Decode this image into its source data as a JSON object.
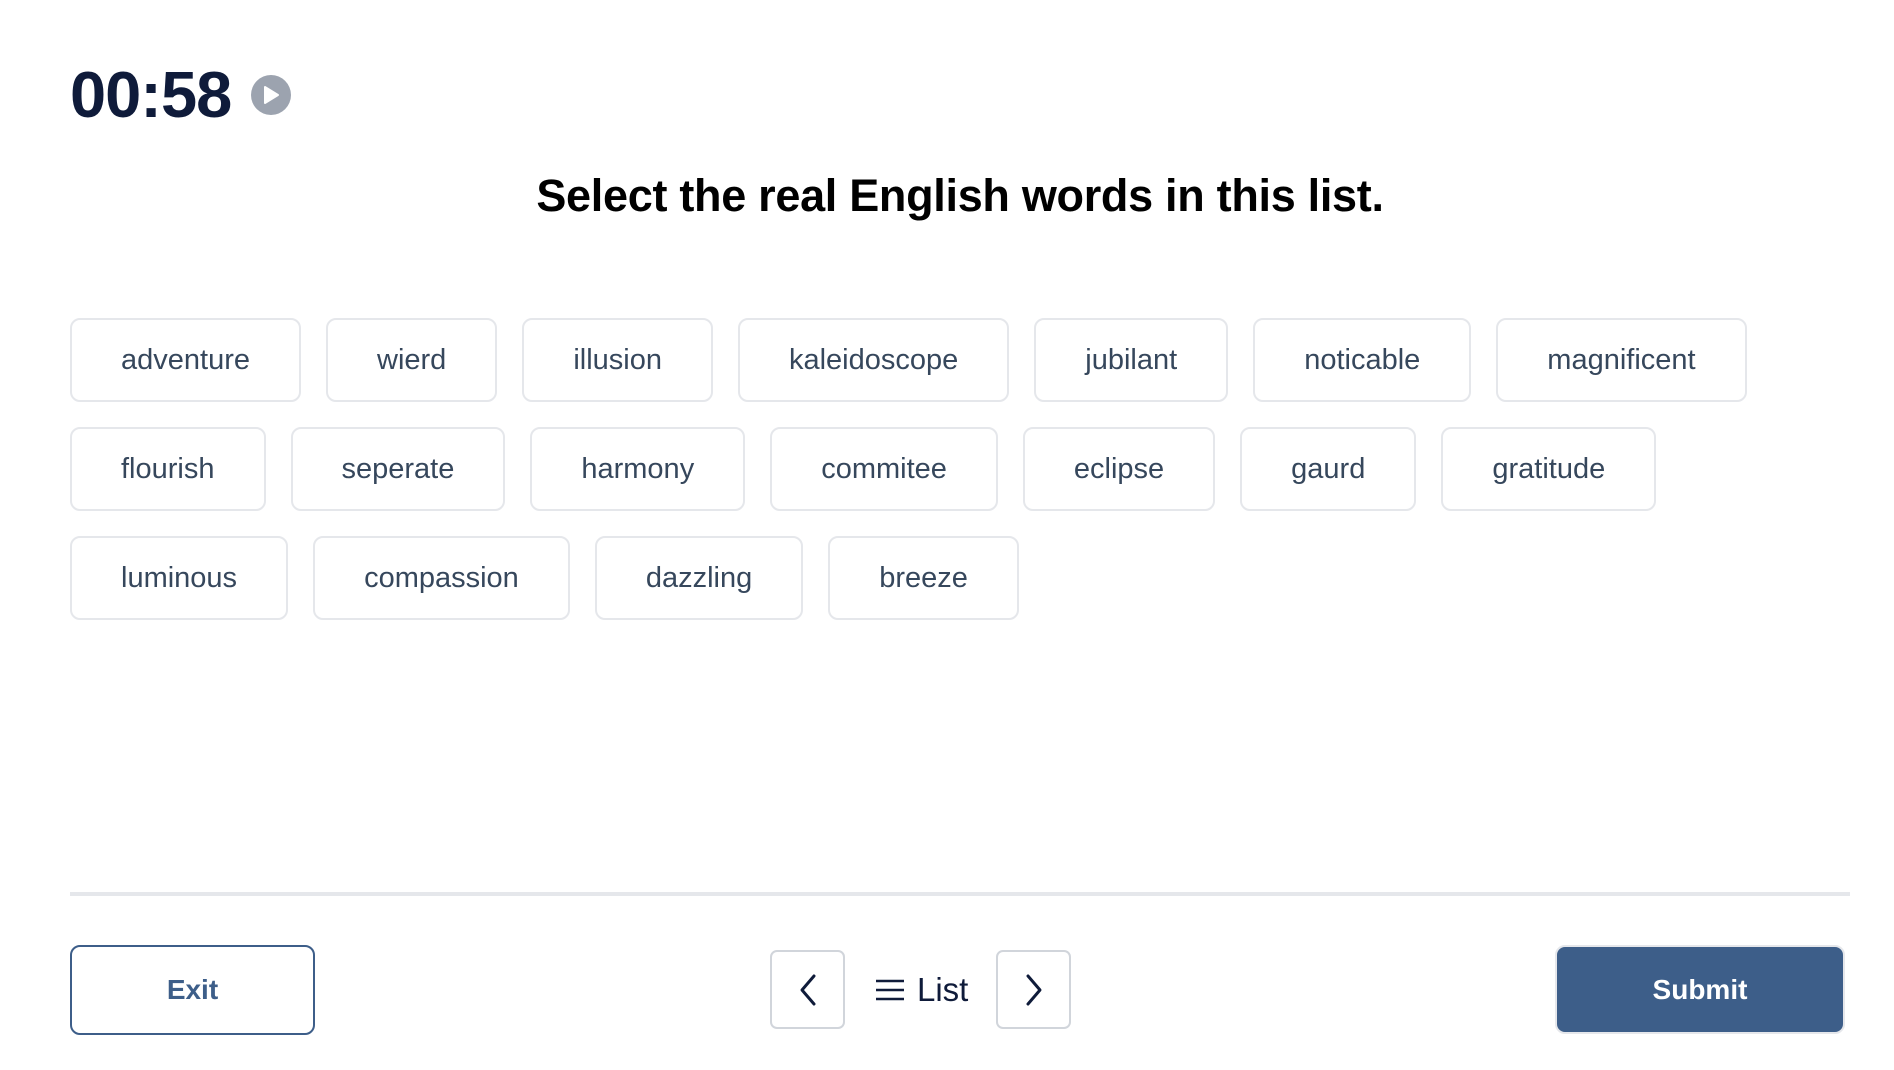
{
  "timer": {
    "value": "00:58",
    "icon": "play-circle-icon"
  },
  "question": {
    "prompt": "Select the real English words in this list."
  },
  "words": [
    "adventure",
    "wierd",
    "illusion",
    "kaleidoscope",
    "jubilant",
    "noticable",
    "magnificent",
    "flourish",
    "seperate",
    "harmony",
    "commitee",
    "eclipse",
    "gaurd",
    "gratitude",
    "luminous",
    "compassion",
    "dazzling",
    "breeze"
  ],
  "footer": {
    "exit_label": "Exit",
    "prev_icon": "chevron-left-icon",
    "list_icon": "menu-icon",
    "list_label": "List",
    "next_icon": "chevron-right-icon",
    "submit_label": "Submit"
  },
  "colors": {
    "primary": "#3d5e89",
    "timer_text": "#0f1b3a",
    "word_text": "#36475c",
    "border": "#e5e7eb",
    "play_icon": "#9ca3af"
  }
}
